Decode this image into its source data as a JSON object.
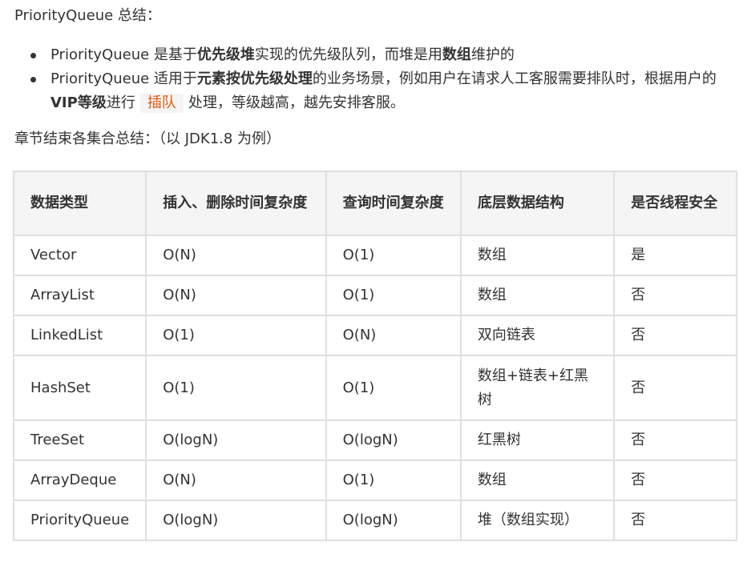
{
  "summary_heading": "PriorityQueue 总结：",
  "bullets": [
    {
      "prefix": "PriorityQueue 是基于",
      "bold1": "优先级堆",
      "middle": "实现的优先级队列，而堆是用",
      "bold2": "数组",
      "suffix": "维护的"
    },
    {
      "prefix": "PriorityQueue 适用于",
      "bold1": "元素按优先级处理",
      "middle": "的业务场景，例如用户在请求人工客服需要排队时，根据用户的",
      "bold2": "VIP等级",
      "before_code": "进行",
      "code": "插队",
      "suffix": "处理，等级越高，越先安排客服。"
    }
  ],
  "chapter_note": "章节结束各集合总结：（以 JDK1.8 为例）",
  "table": {
    "headers": [
      "数据类型",
      "插入、删除时间复杂度",
      "查询时间复杂度",
      "底层数据结构",
      "是否线程安全"
    ],
    "rows": [
      [
        "Vector",
        "O(N)",
        "O(1)",
        "数组",
        "是"
      ],
      [
        "ArrayList",
        "O(N)",
        "O(1)",
        "数组",
        "否"
      ],
      [
        "LinkedList",
        "O(1)",
        "O(N)",
        "双向链表",
        "否"
      ],
      [
        "HashSet",
        "O(1)",
        "O(1)",
        "数组+链表+红黑树",
        "否"
      ],
      [
        "TreeSet",
        "O(logN)",
        "O(logN)",
        "红黑树",
        "否"
      ],
      [
        "ArrayDeque",
        "O(N)",
        "O(1)",
        "数组",
        "否"
      ],
      [
        "PriorityQueue",
        "O(logN)",
        "O(logN)",
        "堆（数组实现）",
        "否"
      ]
    ]
  },
  "colors": {
    "text": "#333333",
    "code_text": "#e8590c",
    "code_bg": "#f4f4f4",
    "table_border": "#dfdfdf",
    "header_bg": "#f5f5f5"
  }
}
